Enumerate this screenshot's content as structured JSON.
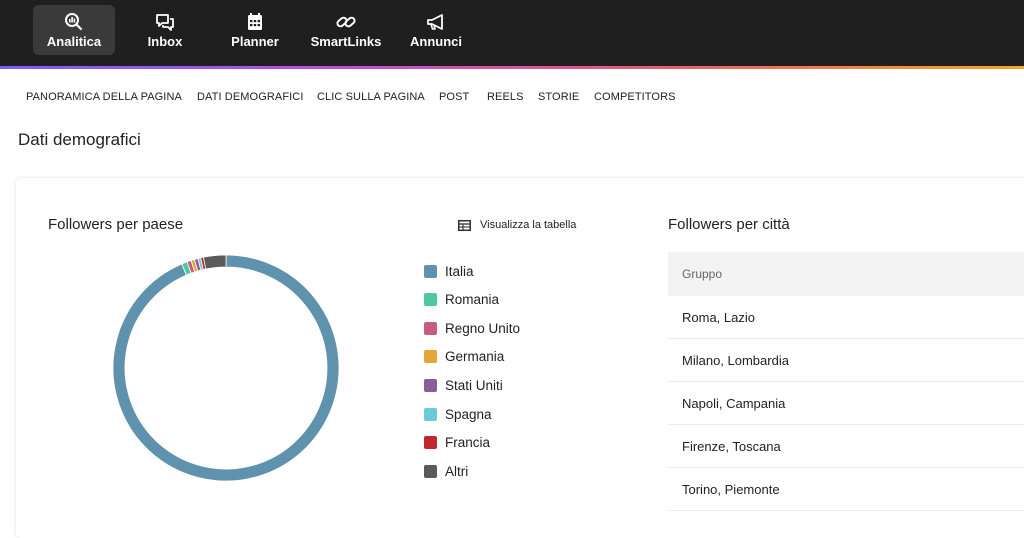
{
  "topnav": {
    "items": [
      {
        "label": "Analitica",
        "icon": "analytics-search-icon",
        "active": true
      },
      {
        "label": "Inbox",
        "icon": "chat-bubbles-icon",
        "active": false
      },
      {
        "label": "Planner",
        "icon": "calendar-icon",
        "active": false
      },
      {
        "label": "SmartLinks",
        "icon": "link-icon",
        "active": false
      },
      {
        "label": "Annunci",
        "icon": "megaphone-icon",
        "active": false
      }
    ]
  },
  "subtabs": [
    "PANORAMICA DELLA PAGINA",
    "DATI DEMOGRAFICI",
    "CLIC SULLA PAGINA",
    "POST",
    "REELS",
    "STORIE",
    "COMPETITORS"
  ],
  "page_title": "Dati demografici",
  "country_section": {
    "title": "Followers per paese",
    "table_link": "Visualizza la tabella"
  },
  "chart_data": {
    "type": "pie",
    "variant": "donut",
    "title": "Followers per paese",
    "legend_position": "right",
    "categories": [
      "Italia",
      "Romania",
      "Regno Unito",
      "Germania",
      "Stati Uniti",
      "Spagna",
      "Francia",
      "Altri"
    ],
    "values": [
      93.6,
      0.8,
      0.6,
      0.5,
      0.5,
      0.4,
      0.4,
      3.2
    ],
    "colors": [
      "#5f93ad",
      "#4fc7a0",
      "#c95b83",
      "#e6a53a",
      "#8a5c98",
      "#6cc9d8",
      "#c0282e",
      "#5a5a5a"
    ]
  },
  "city_section": {
    "title": "Followers per città",
    "column_header": "Gruppo",
    "rows": [
      "Roma, Lazio",
      "Milano, Lombardia",
      "Napoli, Campania",
      "Firenze, Toscana",
      "Torino, Piemonte"
    ]
  },
  "colors": {
    "nav_bg": "#1f1f1f",
    "nav_active_bg": "#3a3a3a"
  }
}
